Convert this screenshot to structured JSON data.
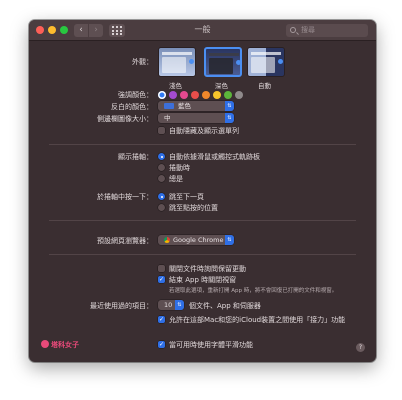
{
  "window": {
    "title": "一般",
    "search_placeholder": "搜尋"
  },
  "appearance": {
    "label": "外觀：",
    "options": [
      {
        "name": "淺色",
        "selected": false
      },
      {
        "name": "深色",
        "selected": true
      },
      {
        "name": "自動",
        "selected": false
      }
    ]
  },
  "accent": {
    "label": "強調顏色：",
    "colors": [
      "#2f7bf5",
      "#a34bd0",
      "#e4498f",
      "#e84e4b",
      "#f0872b",
      "#f6c42b",
      "#5cb53b",
      "#8f8a8b"
    ]
  },
  "highlight": {
    "label": "反白的顏色：",
    "value": "藍色"
  },
  "sidebar_icon": {
    "label": "側邊欄圖像大小：",
    "value": "中"
  },
  "auto_hide_menubar": {
    "label": "自動隱藏及顯示選單列",
    "checked": false
  },
  "scrollbars": {
    "label": "顯示捲軸：",
    "options": [
      {
        "text": "自動依據滑鼠或觸控式軌跡板",
        "selected": true
      },
      {
        "text": "捲動時",
        "selected": false
      },
      {
        "text": "總是",
        "selected": false
      }
    ]
  },
  "click_scrollbar": {
    "label": "於捲軸中按一下：",
    "options": [
      {
        "text": "跳至下一頁",
        "selected": true
      },
      {
        "text": "跳至點按的位置",
        "selected": false
      }
    ]
  },
  "default_browser": {
    "label": "預設網頁瀏覽器：",
    "value": "Google Chrome"
  },
  "ask_keep_changes": {
    "label": "關閉文件時詢問保留更動",
    "checked": false
  },
  "close_windows": {
    "label": "結束 App 時關閉視窗",
    "checked": true,
    "note": "若選取此選項，重新打開 App 時，將不會回復已打開的文件和視窗。"
  },
  "recent_items": {
    "label": "最近使用過的項目：",
    "value": "10",
    "suffix": "個文件、App 和伺服器"
  },
  "handoff": {
    "label": "允許在這部Mac和您的iCloud裝置之間使用「接力」功能",
    "checked": true
  },
  "font_smoothing": {
    "label": "當可用時使用字體平滑功能",
    "checked": true
  },
  "watermark": {
    "text": "塔科女子"
  },
  "help": {
    "label": "?"
  }
}
